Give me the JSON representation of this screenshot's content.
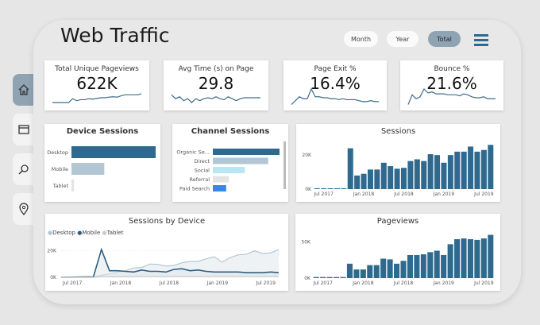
{
  "header": {
    "title": "Web Traffic",
    "filters": [
      {
        "label": "Month",
        "active": false
      },
      {
        "label": "Year",
        "active": false
      },
      {
        "label": "Total",
        "active": true
      }
    ],
    "menu_icon": "hamburger-icon"
  },
  "sidebar": {
    "items": [
      {
        "icon": "home-icon",
        "active": true
      },
      {
        "icon": "browser-window-icon",
        "active": false
      },
      {
        "icon": "search-icon",
        "active": false
      },
      {
        "icon": "map-pin-icon",
        "active": false
      }
    ]
  },
  "colors": {
    "primary": "#2f6a8e",
    "light": "#b3c6d3",
    "cyan": "#b8e6f5",
    "grey": "#e4e4e4",
    "blue": "#3a86e8"
  },
  "kpis": [
    {
      "label": "Total Unique Pageviews",
      "value": "622K",
      "trend": [
        2,
        2,
        2,
        2,
        2,
        4,
        3,
        3.5,
        3.5,
        4,
        3.8,
        4.2,
        4.5,
        4.5,
        4.8,
        5,
        4.8,
        5.5,
        6,
        6,
        6,
        6,
        6.5
      ]
    },
    {
      "label": "Avg Time (s) on Page",
      "value": "29.8",
      "trend": [
        6,
        4,
        5,
        3,
        4,
        2,
        4,
        3,
        4,
        4.5,
        4,
        5,
        4,
        3.5,
        5,
        4,
        3,
        4,
        4.5,
        4.5,
        4.5,
        4.5,
        4.5
      ]
    },
    {
      "label": "Page Exit %",
      "value": "16.4%",
      "trend": [
        1,
        3,
        5,
        4,
        4,
        9,
        5,
        5,
        4.5,
        4.5,
        4,
        4,
        3.5,
        4,
        3.5,
        3.5,
        3.5,
        3,
        2.5,
        2.5,
        3,
        2.5,
        2.5
      ]
    },
    {
      "label": "Bounce %",
      "value": "21.6%",
      "trend": [
        1,
        6,
        4,
        5,
        9,
        7,
        7.5,
        6.5,
        6.5,
        6.5,
        6,
        6,
        6,
        5.5,
        6.5,
        6,
        5,
        4.5,
        4.5,
        5,
        4,
        4,
        4
      ]
    }
  ],
  "device_sessions": {
    "title": "Device Sessions",
    "categories": [
      "Desktop",
      "Mobile",
      "Tablet"
    ],
    "values": [
      100,
      39,
      3
    ]
  },
  "channel_sessions": {
    "title": "Channel Sessions",
    "categories": [
      "Organic Se...",
      "Direct",
      "Social",
      "Referral",
      "Paid Search"
    ],
    "values": [
      100,
      83,
      48,
      24,
      20
    ]
  },
  "chart_data": [
    {
      "type": "bar",
      "title": "Sessions",
      "yticks": [
        "0K",
        "20K"
      ],
      "ylim": [
        0,
        28000
      ],
      "xticks": [
        "Jul 2017",
        "Jan 2018",
        "Jul 2018",
        "Jan 2019",
        "Jul 2019"
      ],
      "values": [
        500,
        500,
        500,
        500,
        500,
        24000,
        8000,
        9000,
        11500,
        11500,
        15500,
        13500,
        12000,
        12500,
        16500,
        17500,
        16500,
        20500,
        20000,
        15500,
        20000,
        22000,
        22000,
        25000,
        22000,
        23000,
        26000
      ]
    },
    {
      "type": "bar",
      "title": "Pageviews",
      "yticks": [
        "0K",
        "50K"
      ],
      "ylim": [
        0,
        65000
      ],
      "xticks": [
        "Jul 2017",
        "Jan 2018",
        "Jul 2018",
        "Jan 2019",
        "Jul 2019"
      ],
      "values": [
        1500,
        1500,
        1500,
        1500,
        1500,
        20000,
        12000,
        12000,
        18000,
        18000,
        27000,
        26000,
        20000,
        24000,
        32000,
        32000,
        33000,
        36000,
        38000,
        32000,
        47000,
        54000,
        55000,
        54000,
        53000,
        55000,
        60000
      ]
    },
    {
      "type": "line",
      "title": "Sessions by Device",
      "yticks": [
        "0K",
        "20K"
      ],
      "ylim": [
        0,
        24000
      ],
      "xticks": [
        "Jul 2017",
        "Jan 2018",
        "Jul 2018",
        "Jan 2019",
        "Jul 2019"
      ],
      "series": [
        {
          "name": "Desktop",
          "color": "#b3c6d3",
          "values": [
            0,
            200,
            400,
            500,
            600,
            1500,
            2500,
            4000,
            5000,
            7000,
            7500,
            10000,
            9800,
            8500,
            9000,
            11000,
            12000,
            12000,
            14000,
            15500,
            11500,
            15000,
            17000,
            17500,
            20000,
            18000,
            18500,
            21000
          ]
        },
        {
          "name": "Mobile",
          "color": "#2f5f7e",
          "values": [
            0,
            100,
            200,
            300,
            300,
            21000,
            5000,
            5000,
            4500,
            4000,
            5500,
            4500,
            4500,
            4000,
            6000,
            6500,
            5000,
            5500,
            4500,
            4000,
            4000,
            4000,
            4000,
            3500,
            3500,
            3500,
            4000,
            3500
          ]
        },
        {
          "name": "Tablet",
          "color": "#cccccc",
          "values": [
            0,
            0,
            0,
            0,
            0,
            500,
            500,
            600,
            600,
            700,
            700,
            700,
            700,
            700,
            800,
            800,
            800,
            800,
            800,
            800,
            800,
            800,
            800,
            800,
            800,
            800,
            800,
            800
          ]
        }
      ]
    }
  ]
}
